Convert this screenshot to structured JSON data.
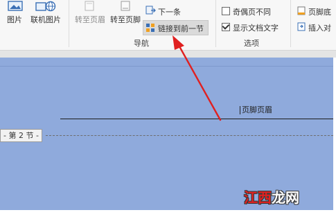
{
  "ribbon": {
    "picture_label": "图片",
    "online_picture_label": "联机图片",
    "to_header_label": "转至页眉",
    "to_footer_label": "转至页脚",
    "next_label": "下一条",
    "link_to_previous_label": "链接到前一节",
    "nav_group_label": "导航",
    "odd_even_label": "奇偶页不同",
    "show_doc_text_label": "显示文档文字",
    "options_group_label": "选项",
    "footer_bottom_label": "页脚底",
    "insert_align_label": "插入对"
  },
  "document": {
    "footer_label": "页脚页眉",
    "section_label": "- 第 2 节 -"
  },
  "watermark": {
    "text_red": "江西",
    "text_white": "龙网"
  },
  "colors": {
    "document_bg": "#8faadc",
    "arrow": "#e02020"
  }
}
